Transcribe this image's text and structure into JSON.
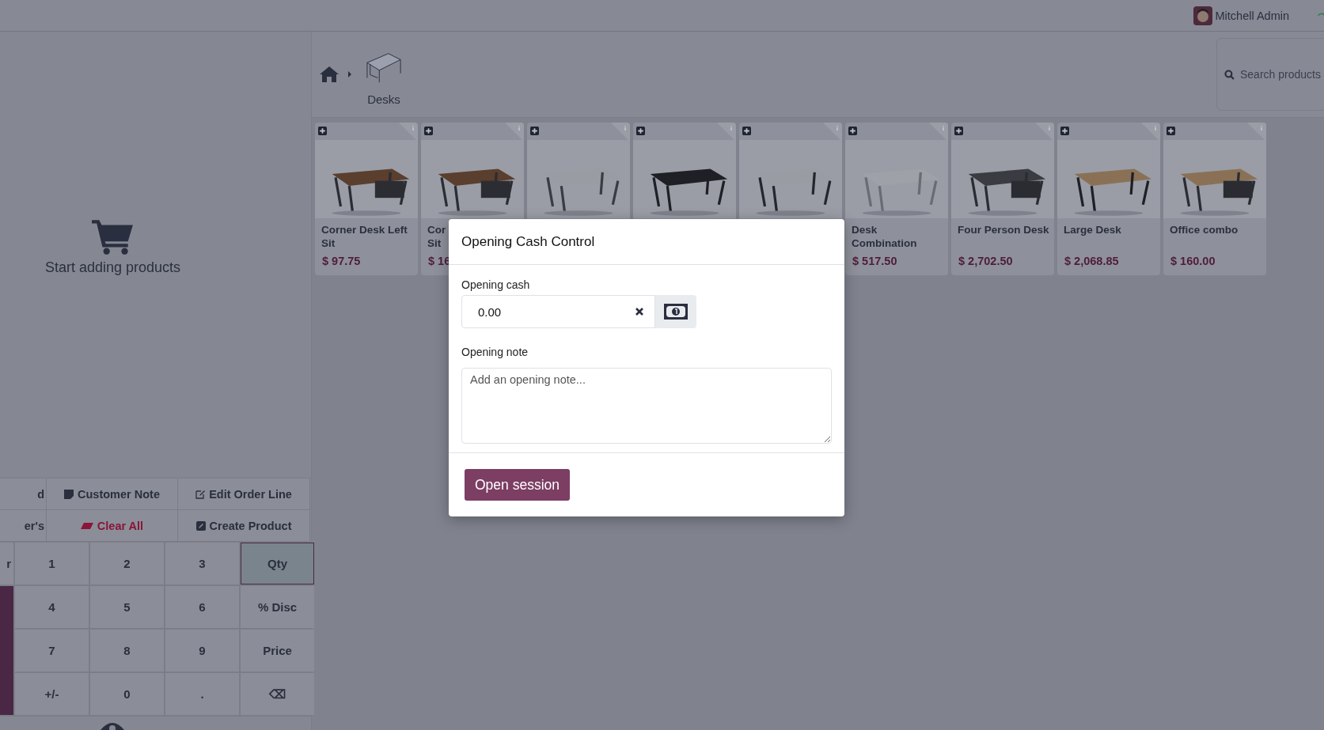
{
  "top_bar": {
    "user": "Mitchell Admin"
  },
  "left_panel": {
    "empty_message": "Start adding products",
    "action_buttons": [
      {
        "label": "d",
        "kind": "plain"
      },
      {
        "label": "Customer Note",
        "kind": "note"
      },
      {
        "label": "Edit Order Line",
        "kind": "edit"
      },
      {
        "label": "er's",
        "kind": "plain"
      },
      {
        "label": "Clear All",
        "kind": "danger"
      },
      {
        "label": "Create Product",
        "kind": "create"
      }
    ],
    "side_keys": [
      {
        "label": "r",
        "kind": "plain"
      },
      {
        "kind": "payment"
      }
    ],
    "numpad": [
      {
        "label": "1",
        "selected": false
      },
      {
        "label": "2",
        "selected": false
      },
      {
        "label": "3",
        "selected": false
      },
      {
        "label": "Qty",
        "selected": true
      },
      {
        "label": "4",
        "selected": false
      },
      {
        "label": "5",
        "selected": false
      },
      {
        "label": "6",
        "selected": false
      },
      {
        "label": "% Disc",
        "selected": false
      },
      {
        "label": "7",
        "selected": false
      },
      {
        "label": "8",
        "selected": false
      },
      {
        "label": "9",
        "selected": false
      },
      {
        "label": "Price",
        "selected": false
      },
      {
        "label": "+/-",
        "selected": false
      },
      {
        "label": "0",
        "selected": false
      },
      {
        "label": ".",
        "selected": false
      },
      {
        "label": "⌫",
        "selected": false
      }
    ]
  },
  "breadcrumb": {
    "category": "Desks"
  },
  "search": {
    "placeholder": "Search products"
  },
  "products": [
    {
      "image": {
        "kind": "picture"
      },
      "name_lines": [
        "Corner Desk Left",
        "Sit"
      ],
      "price": "$ 97.75"
    },
    {
      "image": {
        "kind": "picture"
      },
      "name_lines": [
        "Cor",
        "Sit"
      ],
      "price": "$ 16"
    },
    {
      "image": {
        "kind": "picture"
      }
    },
    {
      "image": {
        "kind": "picture"
      }
    },
    {
      "image": {
        "kind": "picture"
      }
    },
    {
      "image": {
        "kind": "picture"
      },
      "name_lines": [
        "Desk",
        "Combination"
      ],
      "price": "$ 517.50"
    },
    {
      "image": {
        "kind": "picture"
      },
      "name_lines": [
        "Four Person Desk"
      ],
      "price": "$ 2,702.50"
    },
    {
      "image": {
        "kind": "picture"
      },
      "name_lines": [
        "Large Desk"
      ],
      "price": "$ 2,068.85"
    },
    {
      "image": {
        "kind": "picture"
      },
      "name_lines": [
        "Office combo"
      ],
      "price": "$ 160.00"
    }
  ],
  "dialog": {
    "title": "Opening Cash Control",
    "cash_label": "Opening cash",
    "cash_value": "0.00",
    "note_label": "Opening note",
    "note_placeholder": "Add an opening note...",
    "button": "Open session"
  }
}
